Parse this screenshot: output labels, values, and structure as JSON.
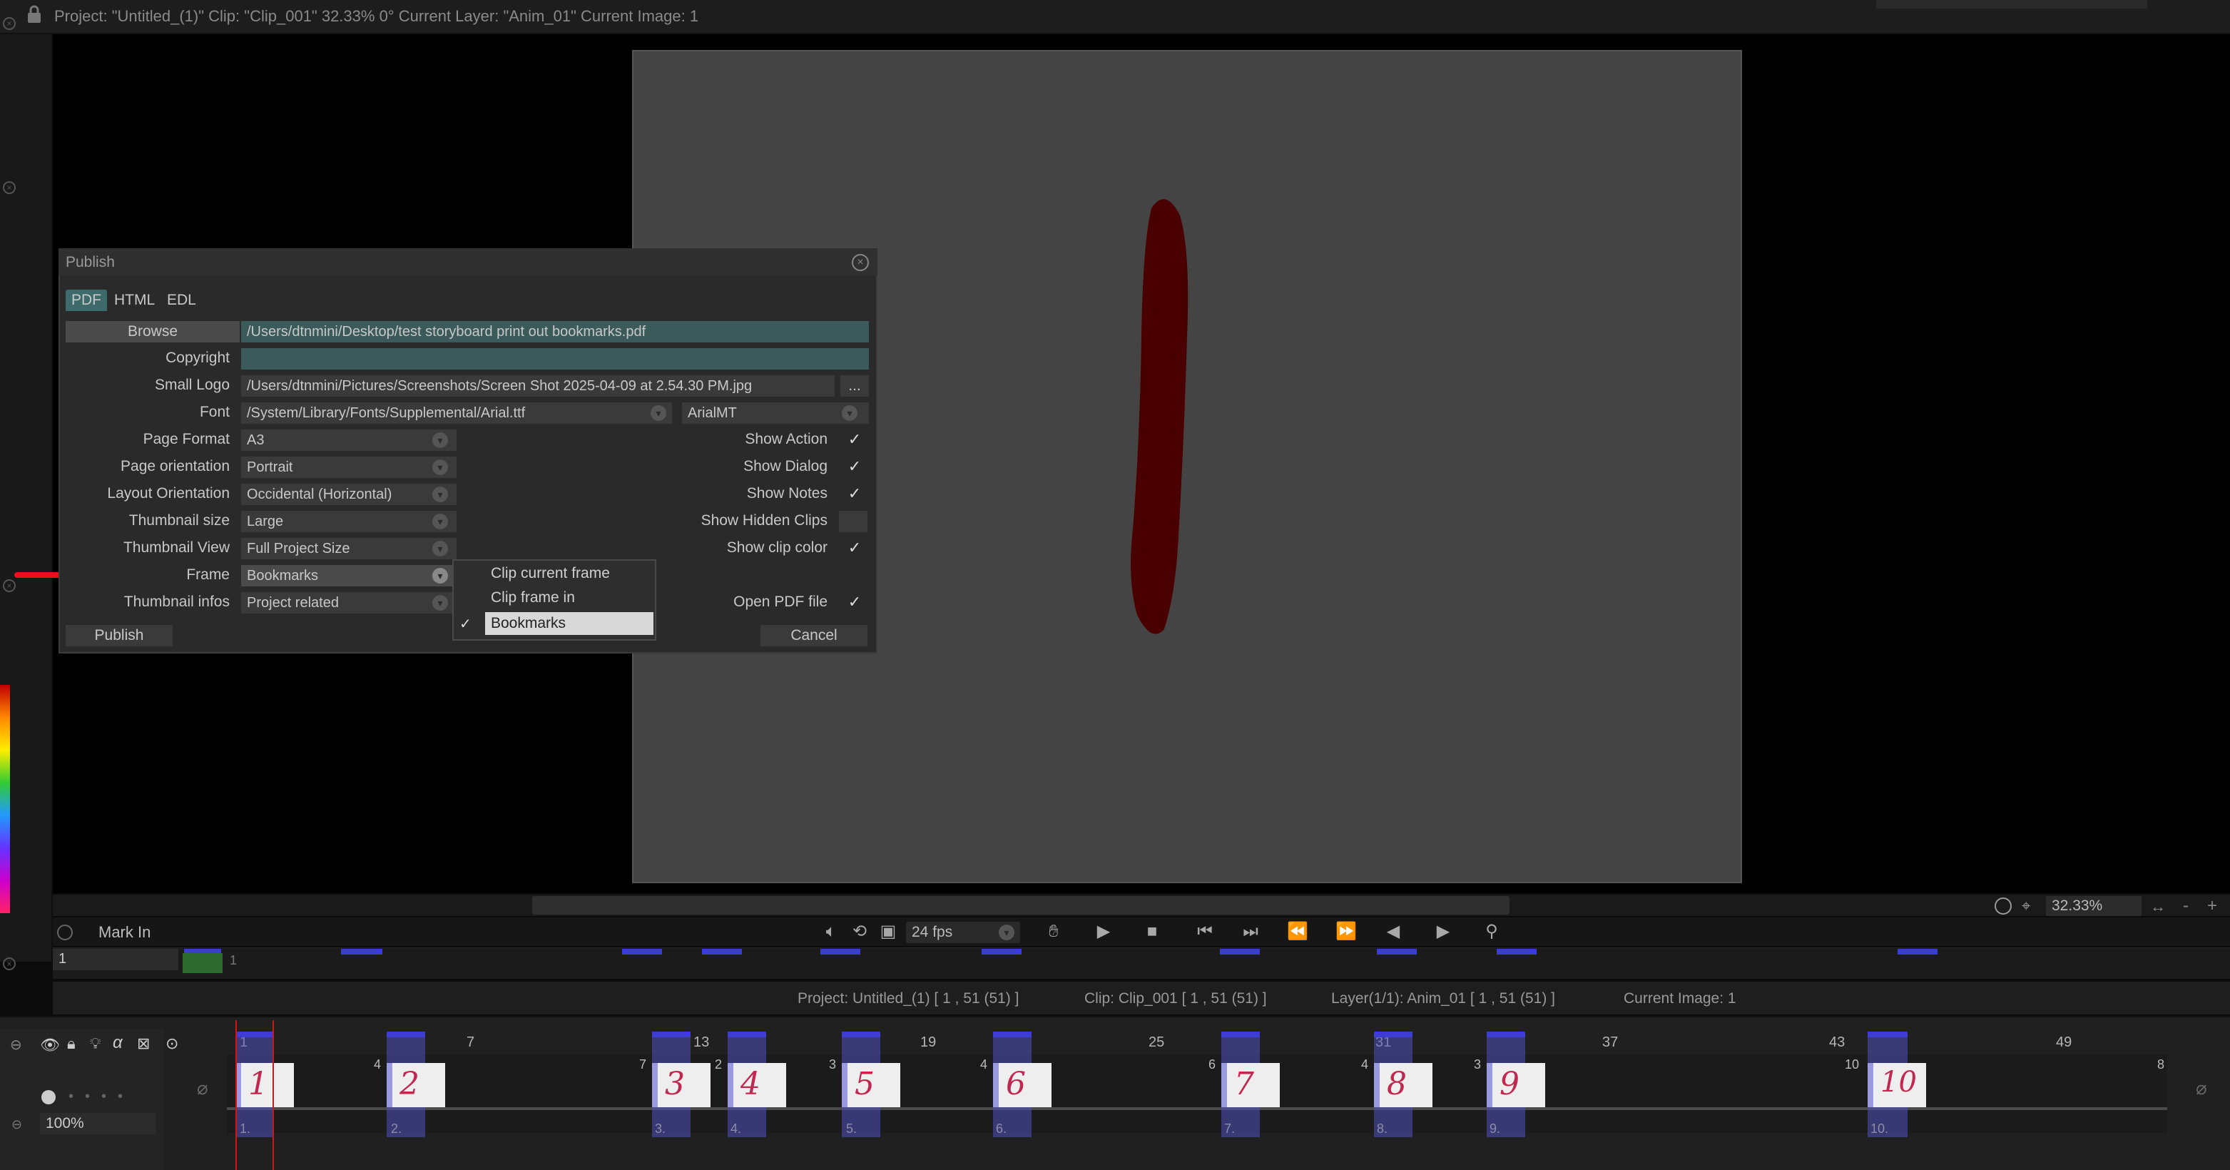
{
  "status_bar": {
    "text": "Project: \"Untitled_(1)\" Clip: \"Clip_001\"   32.33%   0°  Current Layer: \"Anim_01\"  Current Image: 1"
  },
  "transport": {
    "mark_in": "Mark In",
    "fps": "24 fps",
    "zoom": "32.33%",
    "current_frame": "1"
  },
  "ruler": {
    "mark_1": "1"
  },
  "info": {
    "project": "Project: Untitled_(1) [ 1 , 51  (51) ]",
    "clip": "Clip: Clip_001 [ 1 , 51  (51) ]",
    "layer": "Layer(1/1): Anim_01 [ 1 , 51  (51) ]",
    "image": "Current Image: 1"
  },
  "timeline": {
    "numbers": [
      "1",
      "7",
      "13",
      "19",
      "25",
      "31",
      "37",
      "43",
      "49"
    ],
    "opacity": "100%",
    "clips": [
      {
        "drawing": "1",
        "label": "1.",
        "len": ""
      },
      {
        "drawing": "2",
        "label": "2.",
        "len": "4"
      },
      {
        "drawing": "3",
        "label": "3.",
        "len": "7"
      },
      {
        "drawing": "4",
        "label": "4.",
        "len": "2"
      },
      {
        "drawing": "5",
        "label": "5.",
        "len": "3"
      },
      {
        "drawing": "6",
        "label": "6.",
        "len": "4"
      },
      {
        "drawing": "7",
        "label": "7.",
        "len": "6"
      },
      {
        "drawing": "8",
        "label": "8.",
        "len": "4"
      },
      {
        "drawing": "9",
        "label": "9.",
        "len": "3"
      },
      {
        "drawing": "10",
        "label": "10.",
        "len": "10"
      }
    ],
    "end_len": "8"
  },
  "dialog": {
    "title": "Publish",
    "tabs": [
      "PDF",
      "HTML",
      "EDL"
    ],
    "browse_button": "Browse",
    "path": "/Users/dtnmini/Desktop/test storyboard print out bookmarks.pdf",
    "copyright_label": "Copyright",
    "copyright_value": "",
    "small_logo_label": "Small Logo",
    "small_logo_value": "/Users/dtnmini/Pictures/Screenshots/Screen Shot 2025-04-09 at 2.54.30 PM.jpg",
    "small_logo_more": "...",
    "font_label": "Font",
    "font_path": "/System/Library/Fonts/Supplemental/Arial.ttf",
    "font_name": "ArialMT",
    "page_format_label": "Page Format",
    "page_format": "A3",
    "page_orientation_label": "Page orientation",
    "page_orientation": "Portrait",
    "layout_orientation_label": "Layout Orientation",
    "layout_orientation": "Occidental (Horizontal)",
    "thumbnail_size_label": "Thumbnail size",
    "thumbnail_size": "Large",
    "thumbnail_view_label": "Thumbnail View",
    "thumbnail_view": "Full Project Size",
    "frame_label": "Frame",
    "frame": "Bookmarks",
    "thumbnail_infos_label": "Thumbnail infos",
    "thumbnail_infos": "Project related",
    "show_action": "Show Action",
    "show_dialog": "Show Dialog",
    "show_notes": "Show Notes",
    "show_hidden_clips": "Show Hidden Clips",
    "show_clip_color": "Show clip color",
    "open_pdf": "Open PDF file",
    "publish_button": "Publish",
    "cancel_button": "Cancel",
    "frame_menu": [
      "Clip current frame",
      "Clip frame in",
      "Bookmarks"
    ]
  },
  "colors": {
    "accent_teal": "#3d6b6b",
    "clip_blue": "#3d3dd6",
    "stroke": "#4a0000",
    "playhead": "#dd1111"
  }
}
